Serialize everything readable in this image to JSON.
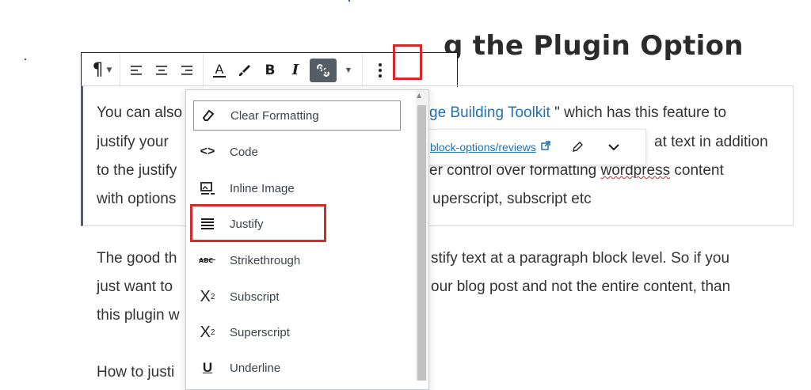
{
  "heading_partial": "g the Plugin Option",
  "toolbar": {
    "paragraph_icon": "pilcrow-icon",
    "align_left_icon": "align-left-icon",
    "align_center_icon": "align-center-icon",
    "align_right_icon": "align-right-icon",
    "text_color_label": "A",
    "highlight_icon": "brush-icon",
    "bold_label": "B",
    "italic_label": "I",
    "unlink_icon": "unlink-icon",
    "more_rich_text_icon": "chevron-down-icon",
    "more_options_icon": "vertical-ellipsis-icon"
  },
  "paragraph1": {
    "line1_before": "You can also",
    "line1_link": "ge Building Toolkit",
    "line1_after": " \" which has this feature to",
    "line2_before": "justify your",
    "line2_after": "at text in addition",
    "line3_before": "to the justify",
    "line3_after_a": "er control over formatting ",
    "line3_misspelled": "wordpress",
    "line3_after_b": " content",
    "line4_before": "with options",
    "line4_after": "uperscript, subscript etc"
  },
  "popover": {
    "url": "block-options/reviews",
    "external_icon": "external-link-icon",
    "edit_icon": "pencil-icon",
    "expand_icon": "chevron-down-icon"
  },
  "paragraph2": {
    "line1_before": "The good th",
    "line1_after": "stify text at a paragraph block level. So if you",
    "line2_before": "just want to",
    "line2_after": "our blog post and not the entire content, than",
    "line3_before": "this plugin w"
  },
  "paragraph3": {
    "line1_before": "How to justi"
  },
  "dropdown": {
    "items": [
      {
        "label": "Clear Formatting",
        "icon": "eraser-icon"
      },
      {
        "label": "Code",
        "icon": "code-icon"
      },
      {
        "label": "Inline Image",
        "icon": "inline-image-icon"
      },
      {
        "label": "Justify",
        "icon": "justify-icon"
      },
      {
        "label": "Strikethrough",
        "icon": "strikethrough-icon"
      },
      {
        "label": "Subscript",
        "icon": "subscript-icon"
      },
      {
        "label": "Superscript",
        "icon": "superscript-icon"
      },
      {
        "label": "Underline",
        "icon": "underline-icon"
      }
    ]
  },
  "colors": {
    "highlight_red": "#d12b2b",
    "link_blue": "#2271b1",
    "active_button": "#555d66"
  }
}
